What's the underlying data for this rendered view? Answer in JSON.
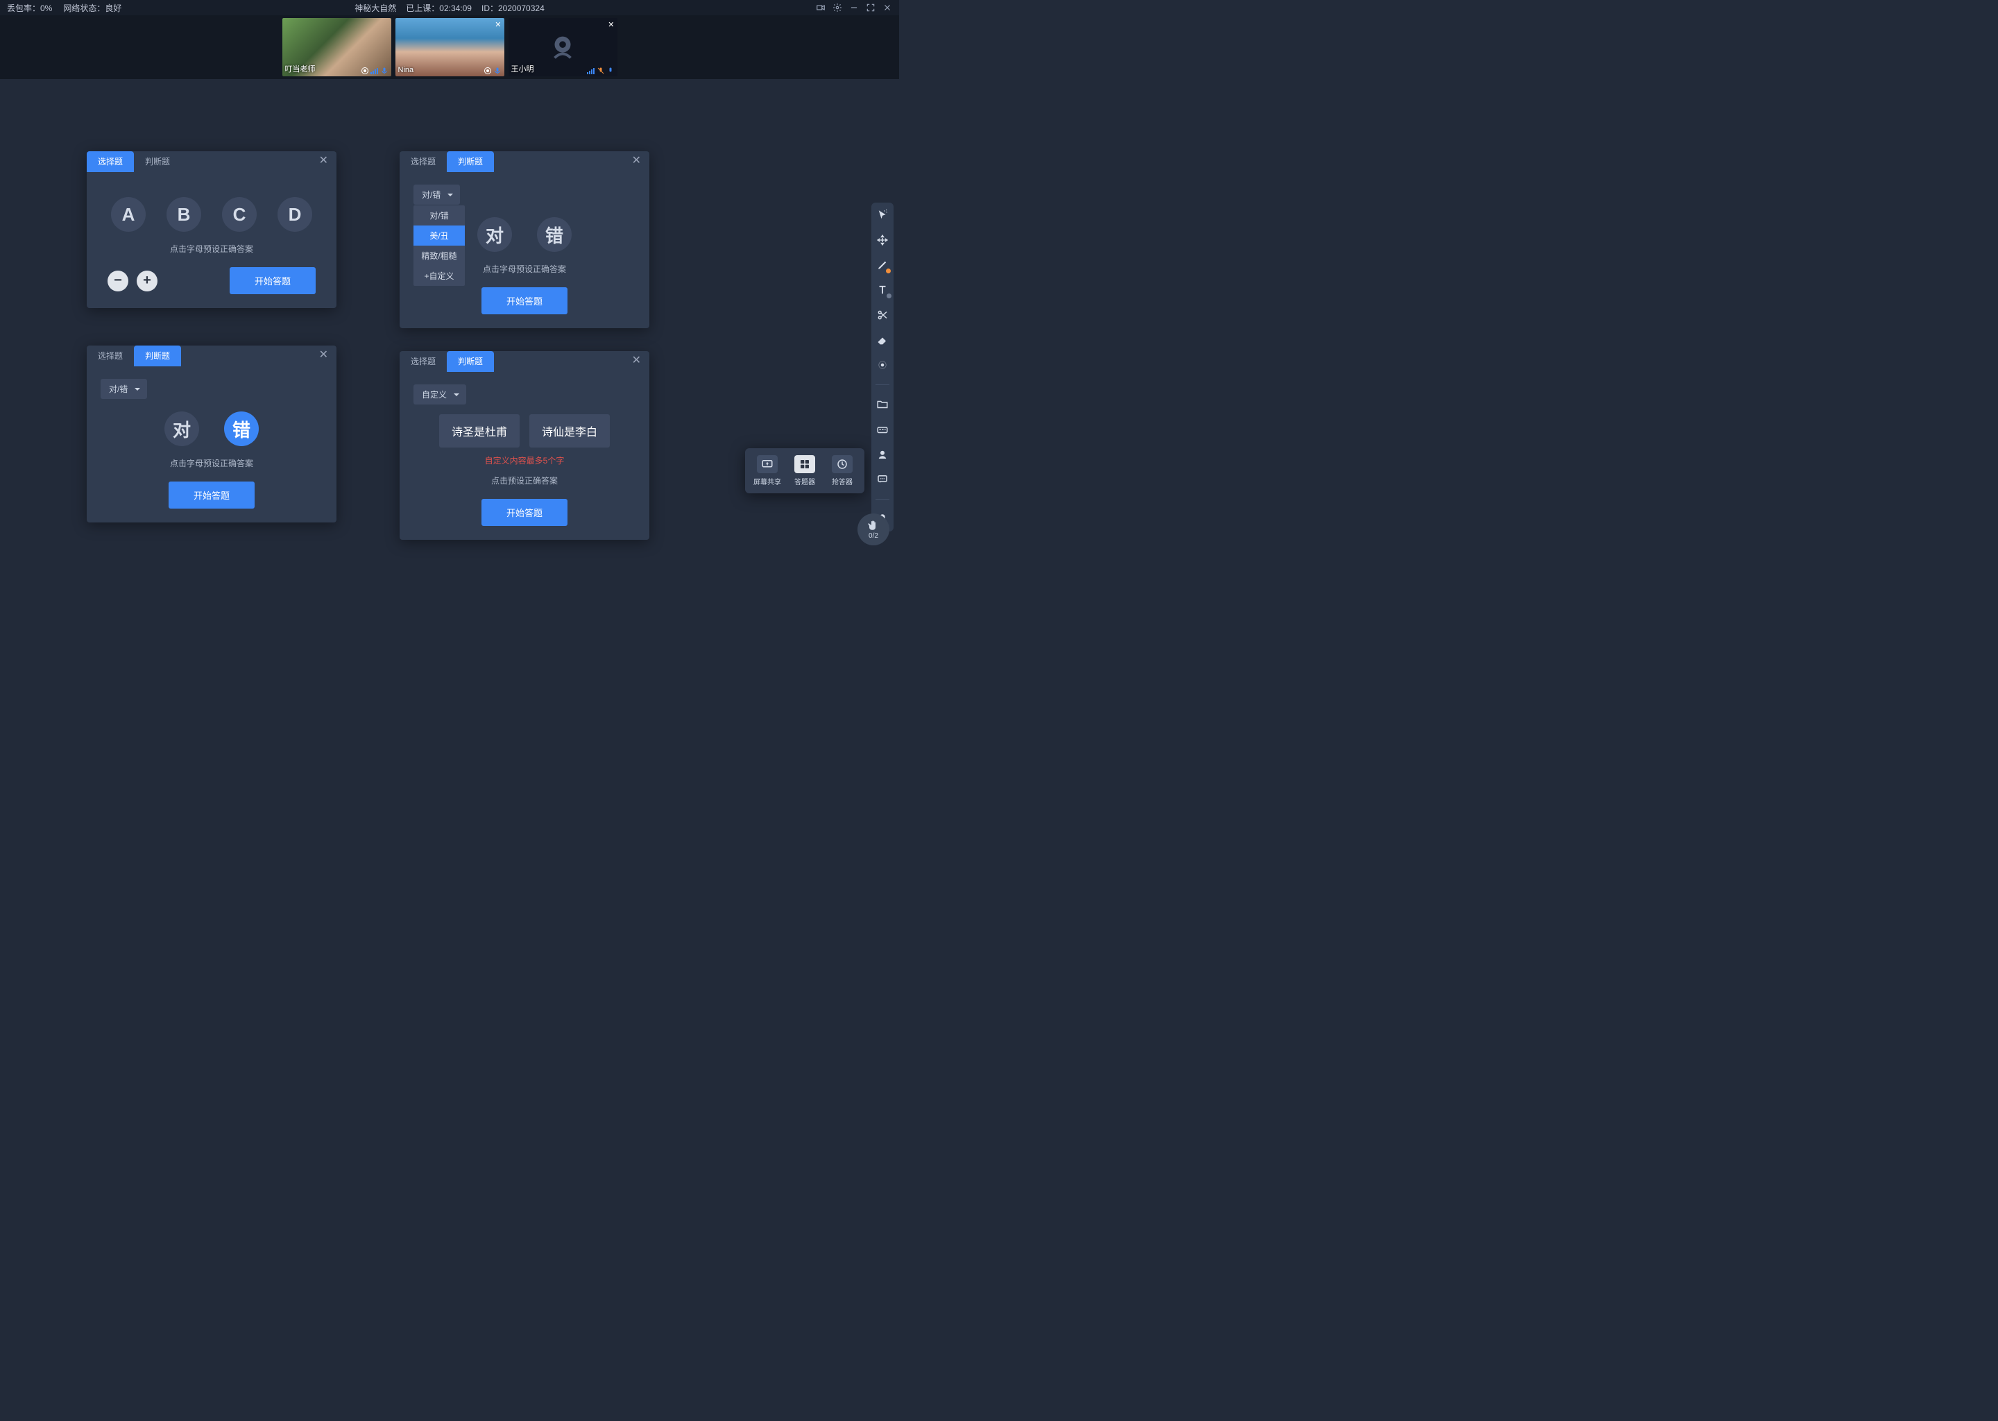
{
  "topbar": {
    "loss": "丢包率：0%",
    "net": "网络状态：良好",
    "title": "神秘大自然",
    "elapsed_label": "已上课：",
    "elapsed": "02:34:09",
    "id_label": "ID：",
    "id": "2020070324"
  },
  "videos": [
    {
      "name": "叮当老师",
      "mic": "blue",
      "closeable": false,
      "feed": "face1"
    },
    {
      "name": "Nina",
      "mic": "blue",
      "closeable": true,
      "feed": "face2"
    },
    {
      "name": "王小明",
      "mic": "orange",
      "closeable": true,
      "feed": "off"
    }
  ],
  "tabs": {
    "choice": "选择题",
    "judge": "判断题"
  },
  "common": {
    "hint": "点击字母预设正确答案",
    "hint2": "点击预设正确答案",
    "start": "开始答题"
  },
  "panel1": {
    "letters": [
      "A",
      "B",
      "C",
      "D"
    ]
  },
  "panel2": {
    "dd_label": "对/错",
    "menu": [
      "对/错",
      "美/丑",
      "精致/粗糙",
      "+自定义"
    ],
    "opts": [
      "对",
      "错"
    ]
  },
  "panel3": {
    "dd_label": "对/错",
    "opts": [
      "对",
      "错"
    ],
    "selectedIndex": 1
  },
  "panel4": {
    "dd_label": "自定义",
    "chips": [
      "诗圣是杜甫",
      "诗仙是李白"
    ],
    "err": "自定义内容最多5个字"
  },
  "actionpop": [
    {
      "label": "屏幕共享",
      "icon": "share"
    },
    {
      "label": "答题器",
      "icon": "quiz",
      "active": true
    },
    {
      "label": "抢答器",
      "icon": "buzz"
    }
  ],
  "hand": {
    "count": "0/2"
  }
}
